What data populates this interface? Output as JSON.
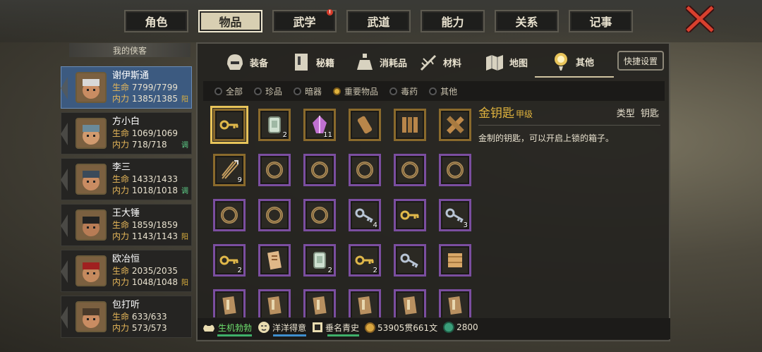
{
  "top_tabs": [
    {
      "label": "角色",
      "active": false,
      "badge": false
    },
    {
      "label": "物品",
      "active": true,
      "badge": false
    },
    {
      "label": "武学",
      "active": false,
      "badge": true
    },
    {
      "label": "武道",
      "active": false,
      "badge": false
    },
    {
      "label": "能力",
      "active": false,
      "badge": false
    },
    {
      "label": "关系",
      "active": false,
      "badge": false
    },
    {
      "label": "记事",
      "active": false,
      "badge": false
    }
  ],
  "badge_text": "!",
  "hero_header": "我的侠客",
  "stat_labels": {
    "hp": "生命",
    "mp": "内力"
  },
  "heroes": [
    {
      "name": "谢伊斯通",
      "hp": "7799/7799",
      "mp": "1385/1385",
      "tag": "阳",
      "tag_color": "#e0b33e",
      "active": true
    },
    {
      "name": "方小白",
      "hp": "1069/1069",
      "mp": "718/718",
      "tag": "调",
      "tag_color": "#5fd18a",
      "active": false
    },
    {
      "name": "李三",
      "hp": "1433/1433",
      "mp": "1018/1018",
      "tag": "调",
      "tag_color": "#5fd18a",
      "active": false
    },
    {
      "name": "王大锤",
      "hp": "1859/1859",
      "mp": "1143/1143",
      "tag": "阳",
      "tag_color": "#e0b33e",
      "active": false
    },
    {
      "name": "欧冶恒",
      "hp": "2035/2035",
      "mp": "1048/1048",
      "tag": "阳",
      "tag_color": "#e0b33e",
      "active": false
    },
    {
      "name": "包打听",
      "hp": "633/633",
      "mp": "573/573",
      "tag": "",
      "tag_color": "#e0b33e",
      "active": false
    }
  ],
  "sub_tabs": [
    {
      "label": "装备",
      "icon": "helmet-icon",
      "active": false
    },
    {
      "label": "秘籍",
      "icon": "book-icon",
      "active": false
    },
    {
      "label": "消耗品",
      "icon": "potion-icon",
      "active": false
    },
    {
      "label": "材料",
      "icon": "herb-icon",
      "active": false
    },
    {
      "label": "地图",
      "icon": "map-icon",
      "active": false
    },
    {
      "label": "其他",
      "icon": "lantern-icon",
      "active": true
    }
  ],
  "quick_settings": "快捷设置",
  "filters": [
    {
      "label": "全部",
      "on": false
    },
    {
      "label": "珍品",
      "on": false
    },
    {
      "label": "暗器",
      "on": false
    },
    {
      "label": "重要物品",
      "on": true
    },
    {
      "label": "毒药",
      "on": false
    },
    {
      "label": "其他",
      "on": false
    }
  ],
  "items": [
    {
      "icon": "gold-key",
      "quality": "gold",
      "qty": "",
      "selected": true
    },
    {
      "icon": "jade-token",
      "quality": "gold",
      "qty": "2"
    },
    {
      "icon": "crystal",
      "quality": "gold",
      "qty": "11"
    },
    {
      "icon": "wood-scroll",
      "quality": "gold",
      "qty": ""
    },
    {
      "icon": "bamboo-slips",
      "quality": "gold",
      "qty": ""
    },
    {
      "icon": "crossed-slips",
      "quality": "gold",
      "qty": ""
    },
    {
      "icon": "arrows",
      "quality": "gold",
      "qty": "9"
    },
    {
      "icon": "ring",
      "quality": "purple",
      "qty": ""
    },
    {
      "icon": "ring",
      "quality": "purple",
      "qty": ""
    },
    {
      "icon": "ring",
      "quality": "purple",
      "qty": ""
    },
    {
      "icon": "ring",
      "quality": "purple",
      "qty": ""
    },
    {
      "icon": "ring",
      "quality": "purple",
      "qty": ""
    },
    {
      "icon": "ring",
      "quality": "purple",
      "qty": ""
    },
    {
      "icon": "ring",
      "quality": "purple",
      "qty": ""
    },
    {
      "icon": "ring",
      "quality": "purple",
      "qty": ""
    },
    {
      "icon": "silver-key",
      "quality": "purple",
      "qty": "4"
    },
    {
      "icon": "gold-key",
      "quality": "purple",
      "qty": ""
    },
    {
      "icon": "silver-key",
      "quality": "purple",
      "qty": "3"
    },
    {
      "icon": "gold-key",
      "quality": "purple",
      "qty": "2"
    },
    {
      "icon": "note",
      "quality": "purple",
      "qty": ""
    },
    {
      "icon": "jade-token",
      "quality": "purple",
      "qty": "2"
    },
    {
      "icon": "gold-key",
      "quality": "purple",
      "qty": "2"
    },
    {
      "icon": "silver-key",
      "quality": "purple",
      "qty": ""
    },
    {
      "icon": "map-scroll",
      "quality": "purple",
      "qty": ""
    },
    {
      "icon": "book",
      "quality": "purple",
      "qty": ""
    },
    {
      "icon": "book",
      "quality": "purple",
      "qty": ""
    },
    {
      "icon": "book",
      "quality": "purple",
      "qty": ""
    },
    {
      "icon": "book",
      "quality": "purple",
      "qty": ""
    },
    {
      "icon": "book",
      "quality": "purple",
      "qty": ""
    },
    {
      "icon": "book",
      "quality": "purple",
      "qty": ""
    }
  ],
  "detail": {
    "name": "金钥匙",
    "grade": "甲级",
    "type_label": "类型",
    "type_value": "钥匙",
    "description": "金制的钥匙，可以开启上锁的箱子。"
  },
  "bottom": {
    "status1": "生机勃勃",
    "status2": "洋洋得意",
    "status3": "垂名青史",
    "money": "53905贯661文",
    "jade": "2800"
  }
}
